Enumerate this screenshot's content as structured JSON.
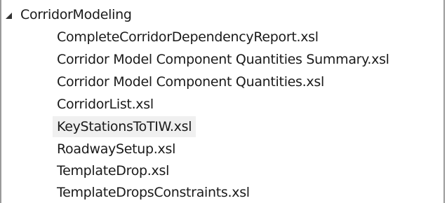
{
  "tree": {
    "root": {
      "label": "CorridorModeling",
      "expanded": true,
      "icon": "expanded-triangle-icon"
    },
    "children": [
      {
        "label": "CompleteCorridorDependencyReport.xsl"
      },
      {
        "label": "Corridor Model Component Quantities Summary.xsl"
      },
      {
        "label": "Corridor Model Component Quantities.xsl"
      },
      {
        "label": "CorridorList.xsl"
      },
      {
        "label": "KeyStationsToTIW.xsl",
        "hovered": true
      },
      {
        "label": "RoadwaySetup.xsl"
      },
      {
        "label": "TemplateDrop.xsl"
      },
      {
        "label": "TemplateDropsConstraints.xsl"
      }
    ]
  },
  "colors": {
    "hover_background": "#f0f0f0",
    "border": "#9a9a9a",
    "text": "#1a1a1a"
  }
}
